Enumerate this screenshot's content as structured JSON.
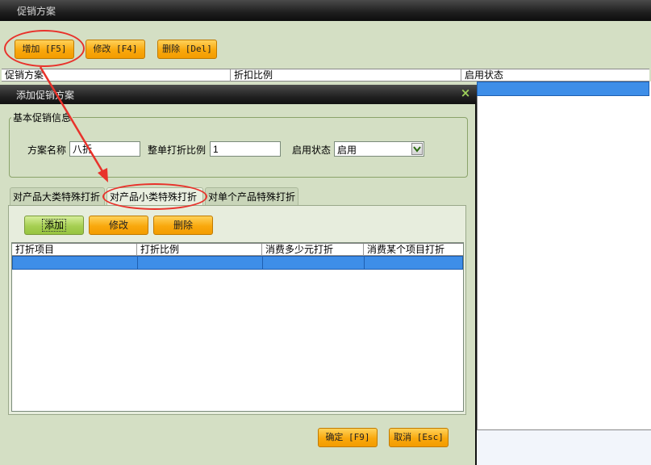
{
  "outer": {
    "title": "促销方案",
    "toolbar": {
      "add": "增加 [F5]",
      "edit": "修改 [F4]",
      "delete": "删除 [Del]"
    },
    "grid_columns": [
      "促销方案",
      "折扣比例",
      "启用状态"
    ]
  },
  "dialog": {
    "title": "添加促销方案",
    "close_glyph": "×",
    "group_title": "基本促销信息",
    "fields": {
      "name_label": "方案名称",
      "name_value": "八折",
      "ratio_label": "整单打折比例",
      "ratio_value": "1",
      "status_label": "启用状态",
      "status_value": "启用"
    },
    "tabs": [
      "对产品大类特殊打折",
      "对产品小类特殊打折",
      "对单个产品特殊打折"
    ],
    "active_tab": 1,
    "tab_buttons": {
      "add": "添加",
      "edit": "修改",
      "delete": "删除"
    },
    "grid_columns": [
      "打折项目",
      "打折比例",
      "消费多少元打折",
      "消费某个项目打折"
    ],
    "ok": "确定 [F9]",
    "cancel": "取消 [Esc]"
  },
  "colors": {
    "annotation_red": "#e8322b",
    "selection_blue": "#3e8ee8",
    "window_bg": "#d4dfc4",
    "orange_button": "#f9a80d",
    "green_button": "#a6cf52"
  },
  "icons": {
    "close": "close-icon",
    "dropdown": "chevron-down-icon",
    "arrow": "annotation-arrow"
  }
}
